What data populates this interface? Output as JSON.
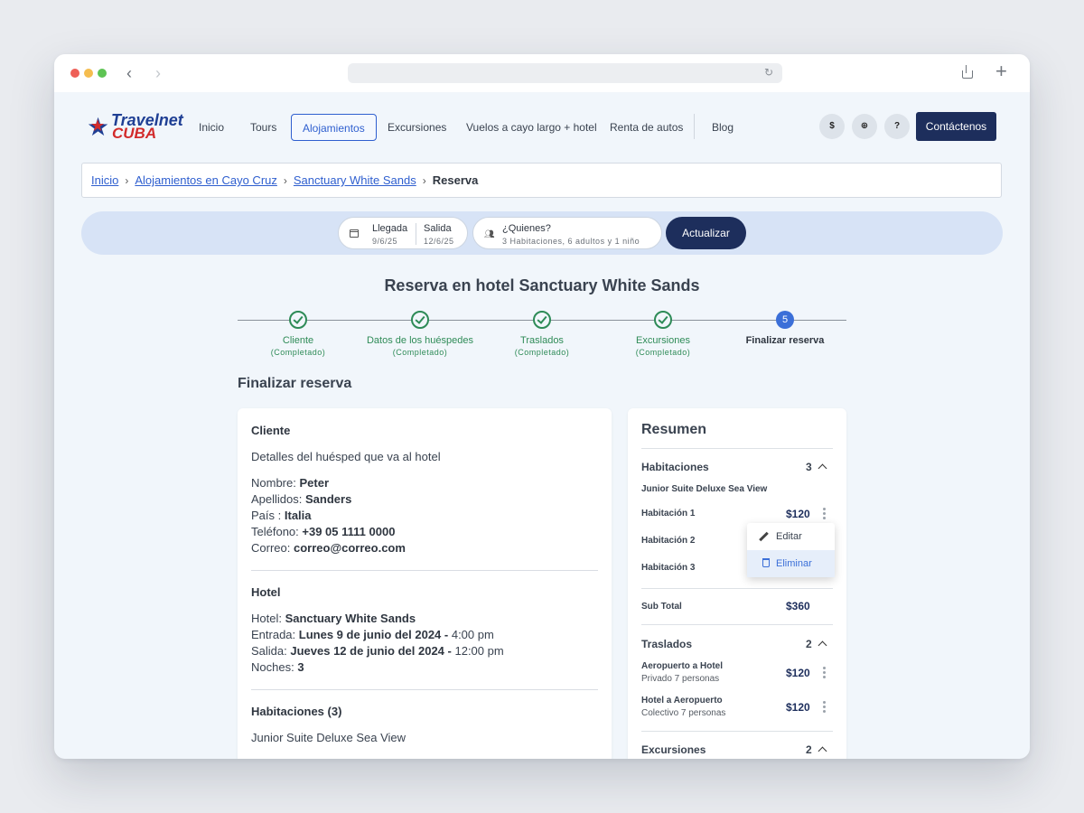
{
  "browser": {
    "back_icon": "chevron-left-icon",
    "forward_icon": "chevron-right-icon",
    "reload_icon": "reload-icon",
    "share_icon": "share-icon",
    "new_tab_icon": "plus-icon"
  },
  "header": {
    "logo": {
      "line1": "Travelnet",
      "line2": "CUBA"
    },
    "menu": [
      "Inicio",
      "Tours",
      "Alojamientos",
      "Excursiones",
      "Vuelos a cayo largo + hotel",
      "Renta de autos",
      "Blog"
    ],
    "active_menu": "Alojamientos",
    "currency_label": "$",
    "language_icon": "globe-icon",
    "help_icon": "help-icon",
    "contact_label": "Contáctenos"
  },
  "breadcrumb": {
    "items": [
      "Inicio",
      "Alojamientos en Cayo Cruz",
      "Sanctuary White Sands"
    ],
    "current": "Reserva"
  },
  "search": {
    "arrival_label": "Llegada",
    "arrival_value": "9/6/25",
    "departure_label": "Salida",
    "departure_value": "12/6/25",
    "who_label": "¿Quienes?",
    "who_value": "3 Habitaciones, 6 adultos y 1 niño",
    "update_label": "Actualizar"
  },
  "page_title": "Reserva en hotel Sanctuary White Sands",
  "stepper": {
    "steps": [
      {
        "label": "Cliente",
        "status": "(Completado)"
      },
      {
        "label": "Datos de los huéspedes",
        "status": "(Completado)"
      },
      {
        "label": "Traslados",
        "status": "(Completado)"
      },
      {
        "label": "Excursiones",
        "status": "(Completado)"
      },
      {
        "label": "Finalizar reserva",
        "status": "",
        "number": "5"
      }
    ]
  },
  "section_title": "Finalizar reserva",
  "client": {
    "title": "Cliente",
    "subtitle": "Detalles del huésped que va al hotel",
    "name_label": "Nombre:",
    "name": "Peter",
    "surname_label": "Apellidos:",
    "surname": "Sanders",
    "country_label": "País :",
    "country": "Italia",
    "phone_label": "Teléfono:",
    "phone": "+39 05 1111 0000",
    "email_label": "Correo:",
    "email": "correo@correo.com"
  },
  "hotel": {
    "title": "Hotel",
    "hotel_label": "Hotel:",
    "hotel_name": "Sanctuary White Sands",
    "checkin_label": "Entrada:",
    "checkin_date": "Lunes 9 de junio del 2024 -",
    "checkin_time": "4:00 pm",
    "checkout_label": "Salida:",
    "checkout_date": "Jueves 12 de junio del 2024 -",
    "checkout_time": "12:00 pm",
    "nights_label": "Noches:",
    "nights": "3"
  },
  "rooms": {
    "title": "Habitaciones (3)",
    "room_type": "Junior Suite Deluxe Sea View"
  },
  "summary": {
    "title": "Resumen",
    "rooms_label": "Habitaciones",
    "rooms_count": "3",
    "room_type": "Junior Suite Deluxe Sea View",
    "room_items": [
      {
        "label": "Habitación 1",
        "price": "$120"
      },
      {
        "label": "Habitación 2",
        "price": ""
      },
      {
        "label": "Habitación 3",
        "price": ""
      }
    ],
    "subtotal_label": "Sub Total",
    "subtotal": "$360",
    "transfers_label": "Traslados",
    "transfers_count": "2",
    "transfers": [
      {
        "label": "Aeropuerto a Hotel",
        "detail": "Privado 7 personas",
        "price": "$120"
      },
      {
        "label": "Hotel a Aeropuerto",
        "detail": "Colectivo 7 personas",
        "price": "$120"
      }
    ],
    "excursions_label": "Excursiones",
    "excursions_count": "2"
  },
  "dropdown": {
    "edit_label": "Editar",
    "delete_label": "Eliminar"
  },
  "colors": {
    "primary": "#1d2e5c",
    "link": "#2f5fcf",
    "success": "#2e8b57",
    "current_step": "#3b6fd8"
  }
}
